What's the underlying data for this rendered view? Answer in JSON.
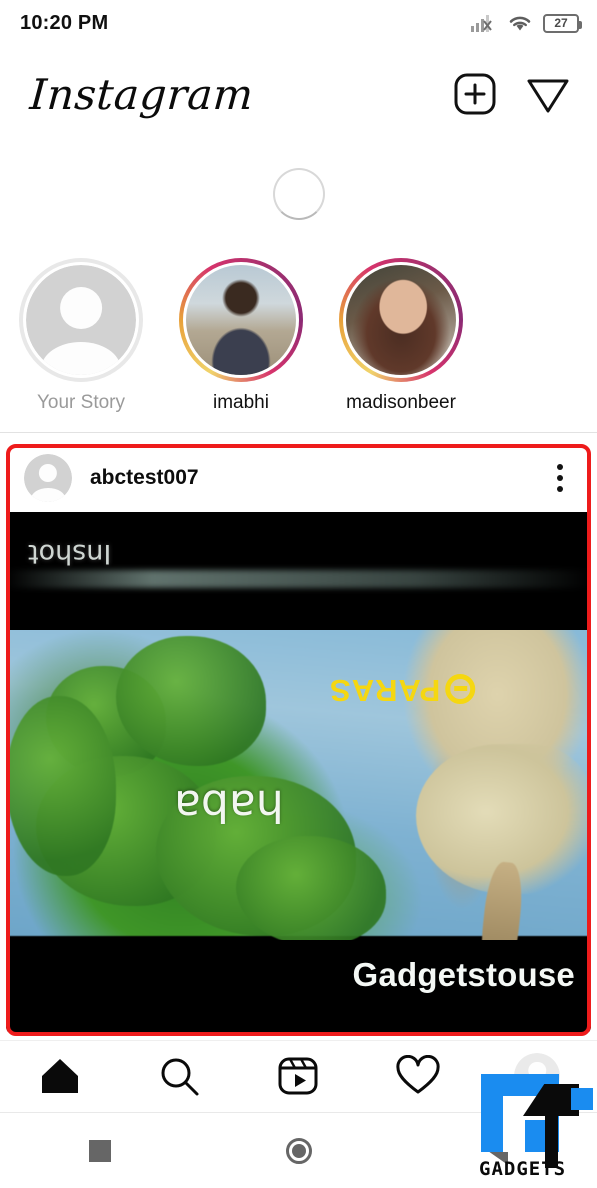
{
  "status_bar": {
    "time": "10:20 PM",
    "signal_icon": "signal-no-sim-icon",
    "wifi_icon": "wifi-icon",
    "battery_level": "27"
  },
  "app_header": {
    "logo_text": "Instagram",
    "add_post_icon": "plus-square-icon",
    "direct_message_icon": "paper-plane-icon"
  },
  "refresh": {
    "spinner_icon": "loading-spinner-icon"
  },
  "stories": {
    "items": [
      {
        "label": "Your Story",
        "has_ring": false,
        "avatar": "placeholder-person-avatar"
      },
      {
        "label": "imabhi",
        "has_ring": true,
        "avatar": "imabhi-profile-photo"
      },
      {
        "label": "madisonbeer",
        "has_ring": true,
        "avatar": "madisonbeer-profile-photo"
      }
    ]
  },
  "post": {
    "username": "abctest007",
    "avatar": "placeholder-person-avatar",
    "menu_icon": "more-options-icon",
    "media_type": "video",
    "watermarks": {
      "inshot": "Inshot",
      "paras": "PARAS",
      "haba": "haba",
      "gadgetstouse": "Gadgetstouse"
    }
  },
  "annotation": {
    "color": "#ee1b1b",
    "shape": "rounded-rectangle"
  },
  "bottom_nav": {
    "items": [
      {
        "name": "home",
        "icon": "home-icon",
        "active": true
      },
      {
        "name": "search",
        "icon": "search-icon",
        "active": false
      },
      {
        "name": "reels",
        "icon": "reels-icon",
        "active": false
      },
      {
        "name": "activity",
        "icon": "heart-icon",
        "active": false
      },
      {
        "name": "profile",
        "icon": "profile-avatar-icon",
        "active": false
      }
    ]
  },
  "android_nav": {
    "recents_icon": "square-recents-icon",
    "home_icon": "circle-home-icon",
    "back_icon": "triangle-back-icon"
  },
  "branding_watermark": {
    "text": "GADGETS",
    "logo_colors": {
      "blue": "#1a8cf0",
      "black": "#0a0a0a"
    }
  }
}
